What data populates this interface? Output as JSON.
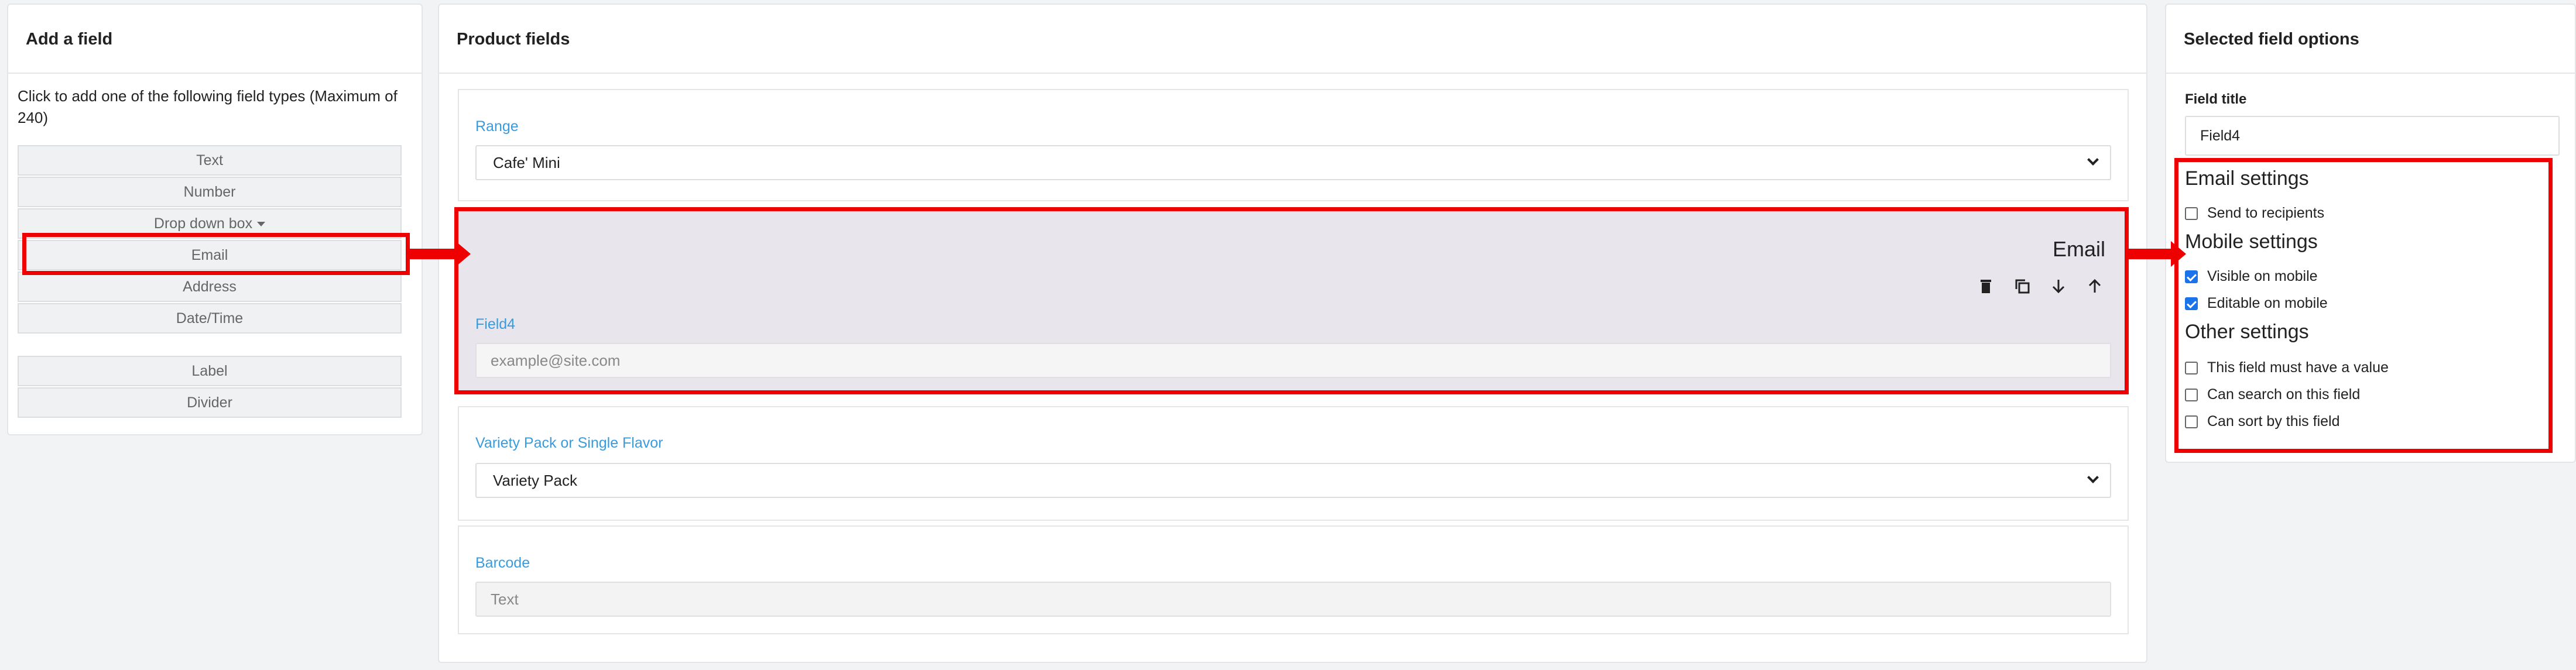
{
  "left_panel": {
    "title": "Add a field",
    "intro": "Click to add one of the following field types (Maximum of 240)",
    "field_types": [
      "Text",
      "Number",
      "Drop down box",
      "Email",
      "Address",
      "Date/Time"
    ],
    "extra_types": [
      "Label",
      "Divider"
    ]
  },
  "middle_panel": {
    "title": "Product fields",
    "fields": {
      "range": {
        "label": "Range",
        "value": "Cafe' Mini"
      },
      "email": {
        "type_label": "Email",
        "label": "Field4",
        "placeholder": "example@site.com"
      },
      "variety": {
        "label": "Variety Pack or Single Flavor",
        "value": "Variety Pack"
      },
      "barcode": {
        "label": "Barcode",
        "placeholder": "Text"
      }
    },
    "toolbar_icons": [
      "delete-icon",
      "copy-icon",
      "move-down-icon",
      "move-up-icon"
    ]
  },
  "right_panel": {
    "title": "Selected field options",
    "field_title_label": "Field title",
    "field_title_value": "Field4",
    "email_settings": {
      "heading": "Email settings",
      "send_to_recipients": {
        "label": "Send to recipients",
        "checked": false
      }
    },
    "mobile_settings": {
      "heading": "Mobile settings",
      "visible_on_mobile": {
        "label": "Visible on mobile",
        "checked": true
      },
      "editable_on_mobile": {
        "label": "Editable on mobile",
        "checked": true
      }
    },
    "other_settings": {
      "heading": "Other settings",
      "must_have_value": {
        "label": "This field must have a value",
        "checked": false
      },
      "can_search": {
        "label": "Can search on this field",
        "checked": false
      },
      "can_sort": {
        "label": "Can sort by this field",
        "checked": false
      }
    }
  },
  "colors": {
    "highlight": "#ee0000",
    "label_blue": "#3a9bdc",
    "checkbox_blue": "#1a73e8"
  }
}
